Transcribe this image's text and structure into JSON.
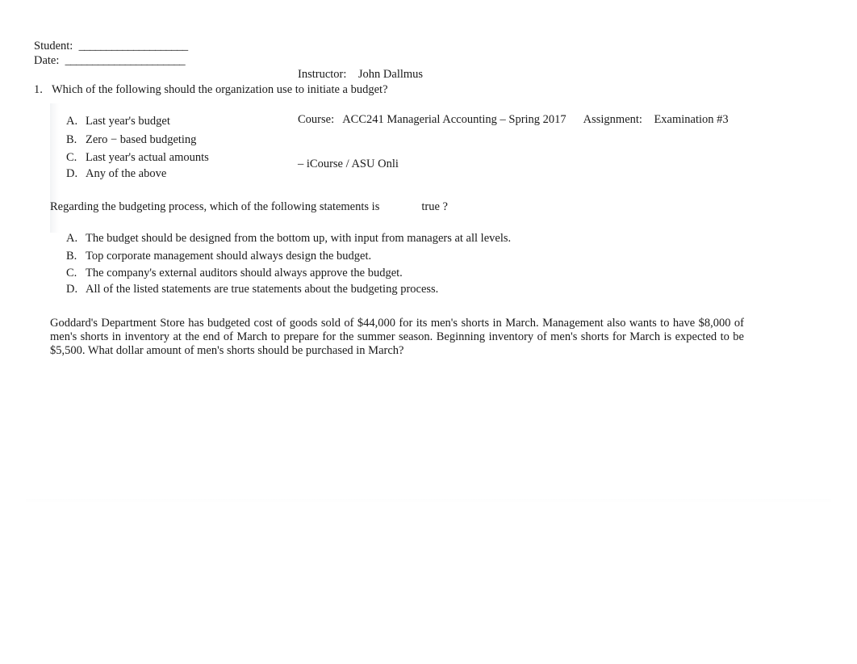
{
  "header": {
    "student_label": "Student:",
    "student_rule": "____________________",
    "date_label": "Date:",
    "date_rule": "______________________",
    "instructor_label": "Instructor:",
    "instructor_name": "John Dallmus",
    "course_label": "Course:",
    "course_name": "ACC241 Managerial Accounting – Spring 2017",
    "assignment_label": "Assignment:",
    "assignment_name": "Examination #3",
    "course_name_cont": "– iCourse / ASU Onli"
  },
  "questions": [
    {
      "number": "1.",
      "stem": "Which of the following should the organization use to initiate a budget?",
      "options": [
        {
          "letter": "A.",
          "text": "Last year's budget"
        },
        {
          "letter": "B.",
          "text": "Zero − based budgeting"
        },
        {
          "letter": "C.",
          "text": "Last year's actual amounts"
        },
        {
          "letter": "D.",
          "text": "Any of the above"
        }
      ]
    },
    {
      "number": "",
      "stem_part1": "Regarding the budgeting process, which of the following statements is",
      "stem_part2": "true ?",
      "options": [
        {
          "letter": "A.",
          "text": "The budget should be designed from the bottom up, with input from managers at all levels."
        },
        {
          "letter": "B.",
          "text": "Top corporate management should always design the budget."
        },
        {
          "letter": "C.",
          "text": "The company's external auditors should always approve the budget."
        },
        {
          "letter": "D.",
          "text": "All of the listed statements are true statements about the budgeting process."
        }
      ]
    },
    {
      "number": "",
      "paragraph": "Goddard's Department Store has budgeted cost of goods sold of $44,000 for its men's shorts in March. Management also wants to have $8,000 of men's shorts in inventory at the end of March to prepare for the summer season. Beginning inventory of men's shorts for March is expected to be $5,500. What dollar amount of men's shorts should be purchased in March?"
    }
  ]
}
